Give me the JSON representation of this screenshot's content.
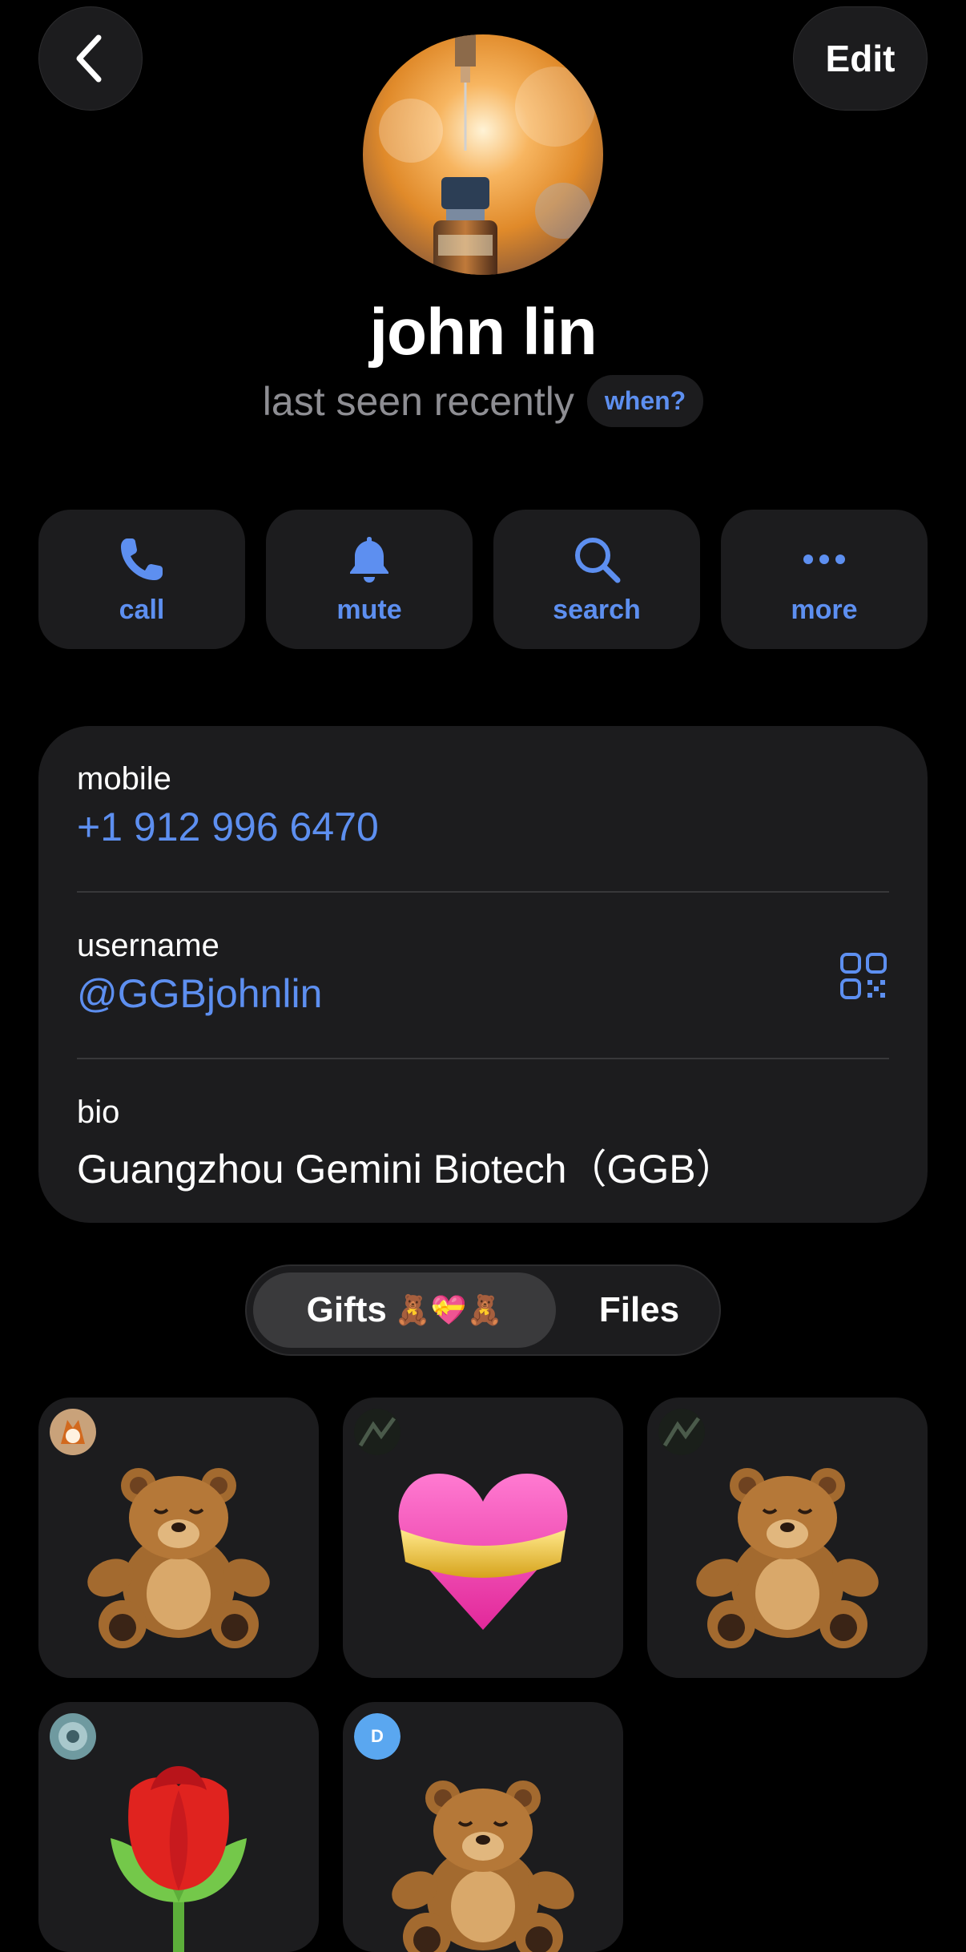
{
  "header": {
    "back_icon": "chevron-left-icon",
    "edit_label": "Edit"
  },
  "profile": {
    "name": "john lin",
    "status": "last seen recently",
    "when_label": "when?"
  },
  "actions": [
    {
      "label": "call",
      "icon": "phone-icon"
    },
    {
      "label": "mute",
      "icon": "bell-icon"
    },
    {
      "label": "search",
      "icon": "search-icon"
    },
    {
      "label": "more",
      "icon": "more-dots-icon"
    }
  ],
  "info": {
    "mobile_label": "mobile",
    "mobile_value": "+1 912 996 6470",
    "username_label": "username",
    "username_value": "@GGBjohnlin",
    "bio_label": "bio",
    "bio_value": "Guangzhou Gemini Biotech（GGB）"
  },
  "tabs": {
    "gifts_label": "Gifts",
    "gifts_emoji": "🧸💝🧸",
    "files_label": "Files"
  },
  "gifts": [
    {
      "item": "teddy-bear",
      "sender": "avatar-fox"
    },
    {
      "item": "heart-with-ribbon",
      "sender": "avatar-dark"
    },
    {
      "item": "teddy-bear",
      "sender": "avatar-dark"
    },
    {
      "item": "rose",
      "sender": "avatar-teal"
    },
    {
      "item": "teddy-bear",
      "sender_initial": "D"
    }
  ],
  "colors": {
    "accent": "#5d8ff0",
    "card": "#1c1c1e",
    "background": "#000000",
    "secondary_text": "#8e8e93"
  }
}
